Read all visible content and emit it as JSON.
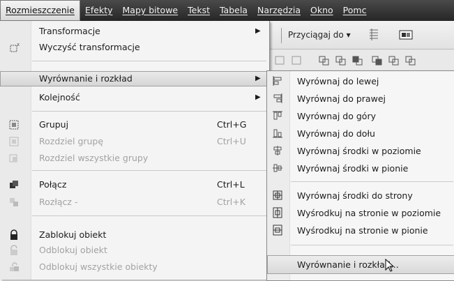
{
  "menubar": {
    "items": [
      {
        "label": "Rozmieszczenie",
        "active": true
      },
      {
        "label": "Efekty"
      },
      {
        "label": "Mapy bitowe"
      },
      {
        "label": "Tekst"
      },
      {
        "label": "Tabela"
      },
      {
        "label": "Narzędzia"
      },
      {
        "label": "Okno"
      },
      {
        "label": "Pomc"
      }
    ]
  },
  "toolbar": {
    "snap_label": "Przyciągaj do",
    "snap_icon": "grid-icon",
    "app_icon": "application-icon"
  },
  "menu": {
    "items": [
      {
        "label": "Transformacje",
        "submenu": true,
        "icon": null
      },
      {
        "label": "Wyczyść transformacje",
        "icon": "clear-transform-icon"
      },
      {
        "label": "Wyrównanie i rozkład",
        "submenu": true,
        "highlight": true
      },
      {
        "label": "Kolejność",
        "submenu": true
      },
      {
        "label": "Grupuj",
        "shortcut": "Ctrl+G",
        "icon": "group-icon"
      },
      {
        "label": "Rozdziel grupę",
        "shortcut": "Ctrl+U",
        "disabled": true,
        "icon": "ungroup-icon"
      },
      {
        "label": "Rozdziel wszystkie grupy",
        "disabled": true,
        "icon": "ungroup-all-icon"
      },
      {
        "label": "Połącz",
        "shortcut": "Ctrl+L",
        "icon": "combine-icon"
      },
      {
        "label": "Rozłącz -",
        "shortcut": "Ctrl+K",
        "disabled": true,
        "icon": "break-apart-icon"
      },
      {
        "label": "Zablokuj obiekt",
        "icon": "lock-icon"
      },
      {
        "label": "Odblokuj obiekt",
        "disabled": true,
        "icon": "unlock-icon"
      },
      {
        "label": "Odblokuj wszystkie obiekty",
        "disabled": true,
        "icon": "unlock-all-icon"
      }
    ]
  },
  "submenu": {
    "items": [
      {
        "label": "Wyrównaj do lewej",
        "icon": "align-left-icon"
      },
      {
        "label": "Wyrównaj do prawej",
        "icon": "align-right-icon"
      },
      {
        "label": "Wyrównaj do góry",
        "icon": "align-top-icon"
      },
      {
        "label": "Wyrównaj do dołu",
        "icon": "align-bottom-icon"
      },
      {
        "label": "Wyrównaj środki w poziomie",
        "icon": "align-center-horizontal-icon"
      },
      {
        "label": "Wyrównaj środki w pionie",
        "icon": "align-center-vertical-icon"
      },
      {
        "label": "Wyrównaj środki do strony",
        "icon": "center-to-page-icon"
      },
      {
        "label": "Wyśrodkuj na stronie w poziomie",
        "icon": "center-page-horizontal-icon"
      },
      {
        "label": "Wyśrodkuj na stronie w pionie",
        "icon": "center-page-vertical-icon"
      },
      {
        "label": "Wyrównanie i rozkład...",
        "highlight": true
      }
    ]
  }
}
